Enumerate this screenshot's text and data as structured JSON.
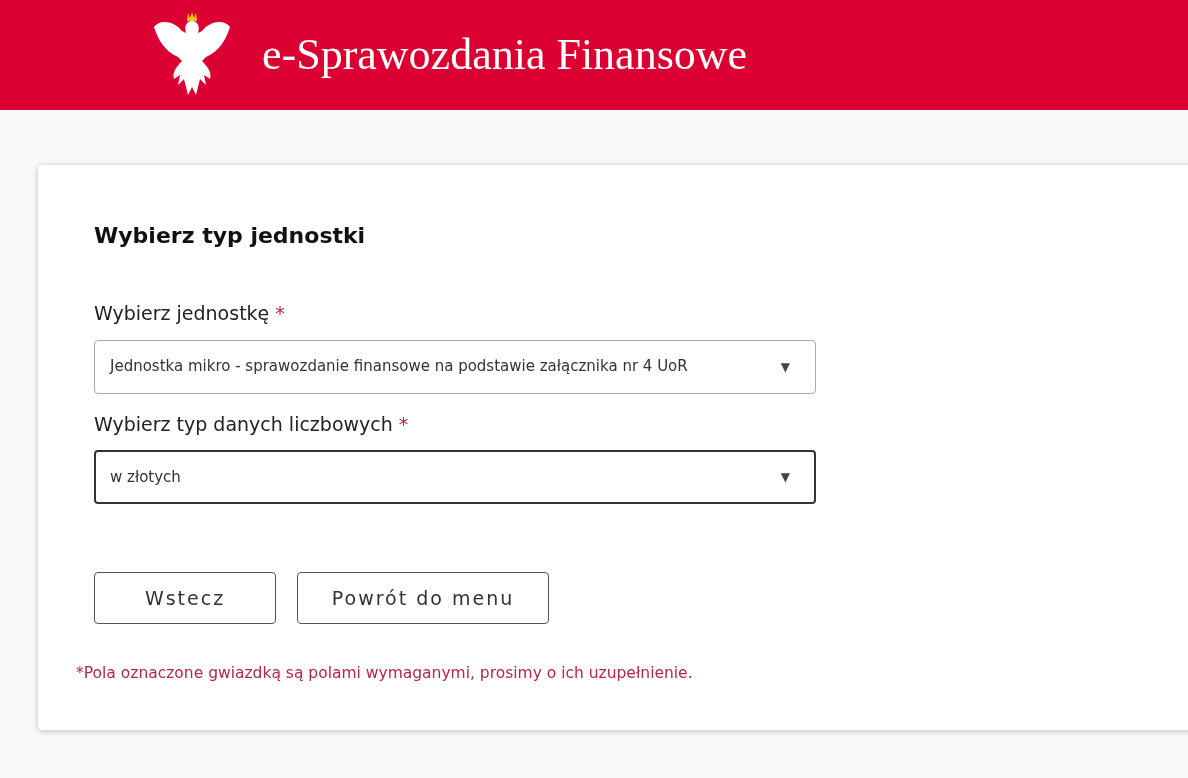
{
  "header": {
    "title": "e-Sprawozdania Finansowe"
  },
  "form": {
    "heading": "Wybierz typ jednostki",
    "fields": [
      {
        "label": "Wybierz jednostkę",
        "required_mark": "*",
        "value": "Jednostka mikro - sprawozdanie finansowe na podstawie załącznika nr 4 UoR",
        "caret": "▼",
        "focused": false
      },
      {
        "label": "Wybierz typ danych liczbowych",
        "required_mark": "*",
        "value": "w złotych",
        "caret": "▼",
        "focused": true
      }
    ],
    "buttons": [
      "Wstecz",
      "Powrót do menu"
    ],
    "note": "*Pola oznaczone gwiazdką są polami wymaganymi, prosimy o ich uzupełnienie."
  }
}
